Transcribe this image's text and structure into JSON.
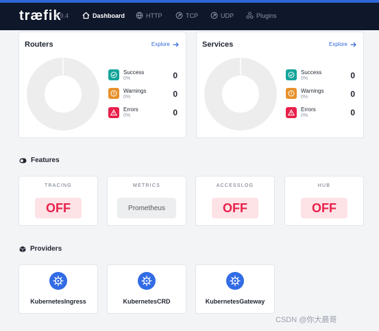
{
  "header": {
    "logo": "træfik",
    "version": "2.9.4",
    "nav": [
      {
        "label": "Dashboard",
        "icon": "home-icon",
        "active": true
      },
      {
        "label": "HTTP",
        "icon": "globe-icon",
        "active": false
      },
      {
        "label": "TCP",
        "icon": "tcp-icon",
        "active": false
      },
      {
        "label": "UDP",
        "icon": "udp-icon",
        "active": false
      },
      {
        "label": "Plugins",
        "icon": "plugins-icon",
        "active": false
      }
    ]
  },
  "routers": {
    "title": "Routers",
    "explore": "Explore",
    "stats": [
      {
        "label": "Success",
        "pct": "0%",
        "count": "0",
        "color": "#13a59a",
        "icon": "check-icon"
      },
      {
        "label": "Warnings",
        "pct": "0%",
        "count": "0",
        "color": "#e8902b",
        "icon": "warning-icon"
      },
      {
        "label": "Errors",
        "pct": "0%",
        "count": "0",
        "color": "#e8204a",
        "icon": "error-icon"
      }
    ]
  },
  "services": {
    "title": "Services",
    "explore": "Explore",
    "stats": [
      {
        "label": "Success",
        "pct": "0%",
        "count": "0",
        "color": "#13a59a",
        "icon": "check-icon"
      },
      {
        "label": "Warnings",
        "pct": "0%",
        "count": "0",
        "color": "#e8902b",
        "icon": "warning-icon"
      },
      {
        "label": "Errors",
        "pct": "0%",
        "count": "0",
        "color": "#e8204a",
        "icon": "error-icon"
      }
    ]
  },
  "features": {
    "title": "Features",
    "items": [
      {
        "label": "TRACING",
        "value": "OFF"
      },
      {
        "label": "METRICS",
        "value": "Prometheus"
      },
      {
        "label": "ACCESSLOG",
        "value": "OFF"
      },
      {
        "label": "HUB",
        "value": "OFF"
      }
    ]
  },
  "providers": {
    "title": "Providers",
    "items": [
      {
        "name": "KubernetesIngress",
        "icon": "kubernetes-icon"
      },
      {
        "name": "KubernetesCRD",
        "icon": "kubernetes-icon"
      },
      {
        "name": "KubernetesGateway",
        "icon": "kubernetes-icon"
      }
    ]
  },
  "watermark": "CSDN @你大晨哥"
}
